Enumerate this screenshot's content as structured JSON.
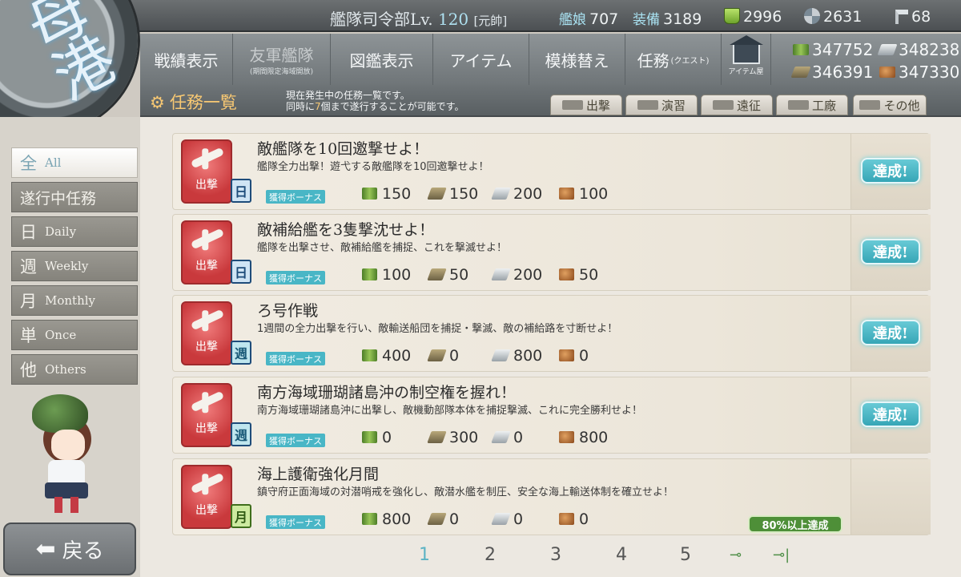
{
  "header": {
    "hq_label": "艦隊司令部Lv.",
    "hq_level": "120",
    "rank": "[元帥]",
    "ships_label": "艦娘",
    "ships_value": "707",
    "equip_label": "装備",
    "equip_value": "3189",
    "bucket_value": "2996",
    "screw_value": "2631",
    "hammer_value": "68"
  },
  "resources": {
    "fuel": "347752",
    "ammo": "348238",
    "steel": "346391",
    "bauxite": "347330"
  },
  "emblem": {
    "text": "母港"
  },
  "nav": {
    "senseki": "戦績表示",
    "yugun": "友軍艦隊",
    "yugun_sub": "(期間限定海域開放)",
    "zukan": "図鑑表示",
    "item": "アイテム",
    "moyou": "模様替え",
    "ninmu": "任務",
    "ninmu_small": "(クエスト)",
    "shop": "アイテム屋"
  },
  "title_strip": {
    "title": "任務一覧",
    "desc_line1": "現在発生中の任務一覧です。",
    "desc_line2_pre": "同時に",
    "desc_line2_num": "7",
    "desc_line2_post": "個まで遂行することが可能です。",
    "tabs": [
      "出撃",
      "演習",
      "遠征",
      "工廠",
      "その他"
    ]
  },
  "sidebar": {
    "all_big": "全",
    "all_en": "All",
    "in_progress": "遂行中任務",
    "daily_big": "日",
    "daily_en": "Daily",
    "weekly_big": "週",
    "weekly_en": "Weekly",
    "monthly_big": "月",
    "monthly_en": "Monthly",
    "once_big": "単",
    "once_en": "Once",
    "others_big": "他",
    "others_en": "Others"
  },
  "back_button": {
    "label": "戻る"
  },
  "bonus_label": "獲得ボーナス",
  "badge_label": "出撃",
  "quests": [
    {
      "title": "敵艦隊を10回邀撃せよ！",
      "desc": "艦隊全力出撃！遊弋する敵艦隊を10回邀撃せよ！",
      "freq": "日",
      "fuel": "150",
      "ammo": "150",
      "steel": "200",
      "baux": "100",
      "status": "達成!"
    },
    {
      "title": "敵補給艦を3隻撃沈せよ！",
      "desc": "艦隊を出撃させ、敵補給艦を捕捉、これを撃滅せよ！",
      "freq": "日",
      "fuel": "100",
      "ammo": "50",
      "steel": "200",
      "baux": "50",
      "status": "達成!"
    },
    {
      "title": "ろ号作戦",
      "desc": "1週間の全力出撃を行い、敵輸送船団を捕捉・撃滅、敵の補給路を寸断せよ！",
      "freq": "週",
      "fuel": "400",
      "ammo": "0",
      "steel": "800",
      "baux": "0",
      "status": "達成!"
    },
    {
      "title": "南方海域珊瑚諸島沖の制空権を握れ！",
      "desc": "南方海域珊瑚諸島沖に出撃し、敵機動部隊本体を捕捉撃滅、これに完全勝利せよ！",
      "freq": "週",
      "fuel": "0",
      "ammo": "300",
      "steel": "0",
      "baux": "800",
      "status": "達成!"
    },
    {
      "title": "海上護衛強化月間",
      "desc": "鎮守府正面海域の対潜哨戒を強化し、敵潜水艦を制圧、安全な海上輸送体制を確立せよ！",
      "freq": "月",
      "fuel": "800",
      "ammo": "0",
      "steel": "0",
      "baux": "0",
      "progress": "80%以上達成"
    }
  ],
  "pagination": {
    "pages": [
      "1",
      "2",
      "3",
      "4",
      "5"
    ],
    "current": "1",
    "next": "⊸",
    "last": "⊸|"
  },
  "colors": {
    "accent": "#49b6c6",
    "title_gold": "#f7c873",
    "badge_red": "#c9393c",
    "progress_green": "#4e8f38"
  }
}
